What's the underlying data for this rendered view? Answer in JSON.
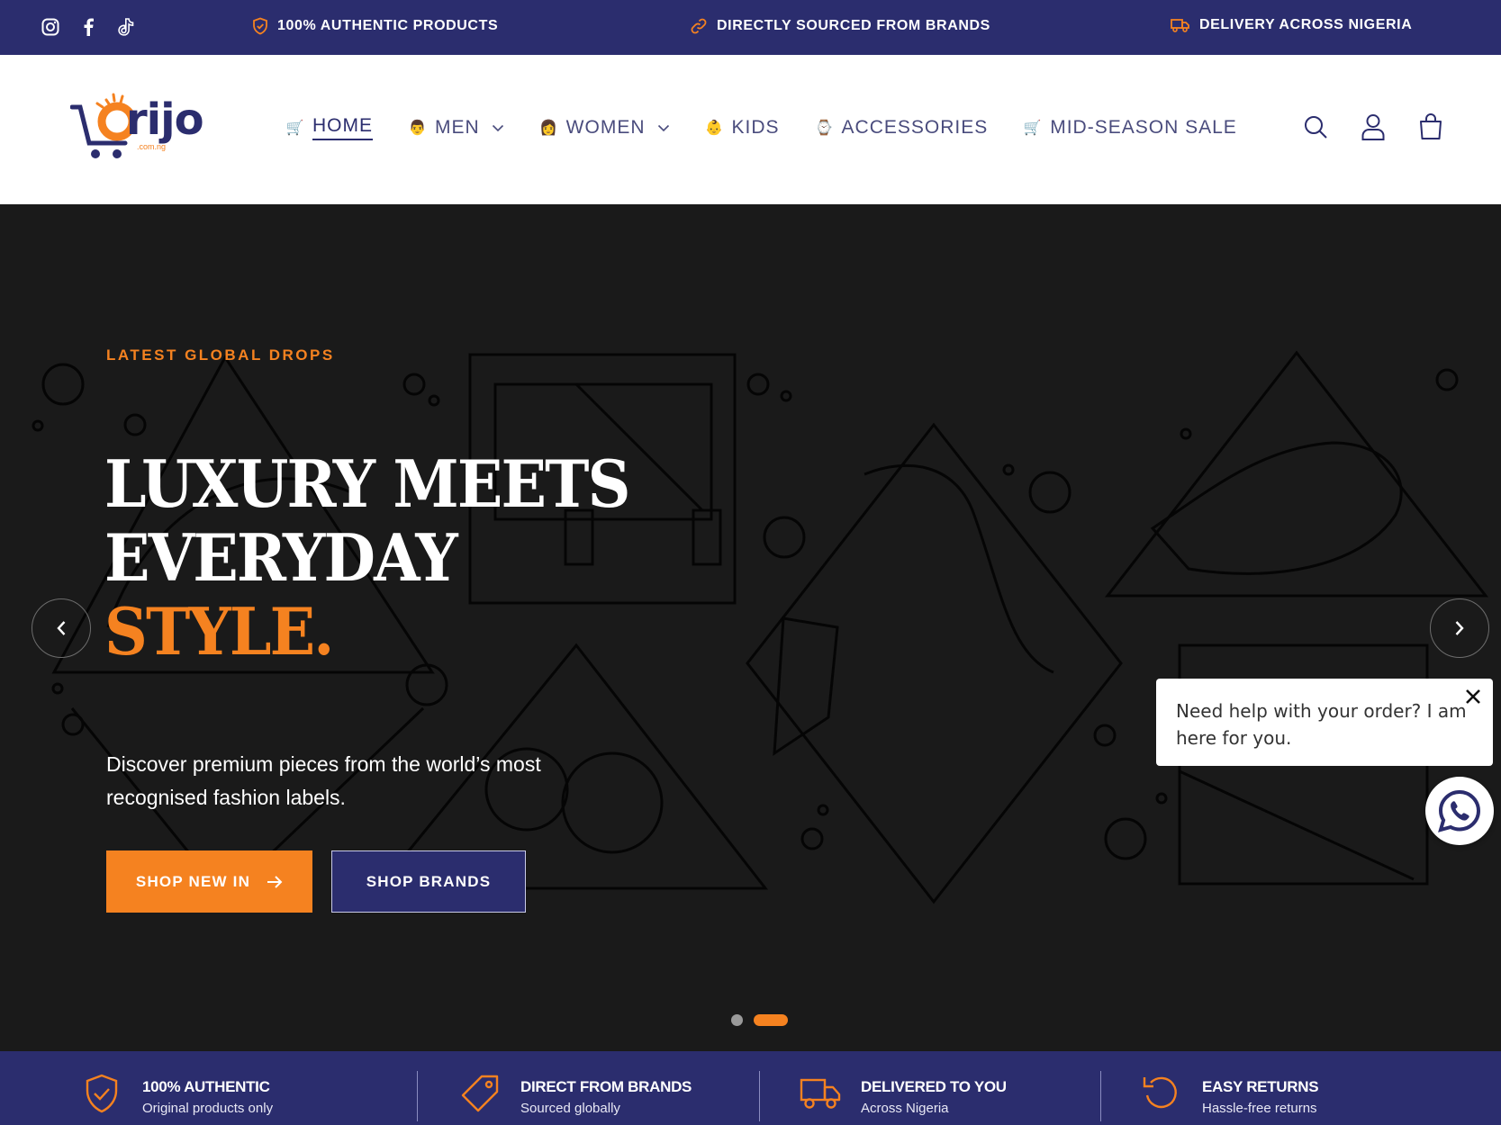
{
  "topbar": {
    "social": [
      "instagram-icon",
      "facebook-icon",
      "tiktok-icon"
    ],
    "promos": [
      {
        "icon": "shield-check-icon",
        "text": "100% AUTHENTIC PRODUCTS"
      },
      {
        "icon": "link-icon",
        "text": "DIRECTLY SOURCED FROM BRANDS"
      },
      {
        "icon": "truck-icon",
        "text": "DELIVERY ACROSS NIGERIA"
      }
    ]
  },
  "header": {
    "logo": {
      "word": "rijo",
      "domain": ".com.ng"
    },
    "nav": [
      {
        "emoji": "🛒",
        "label": "HOME",
        "active": true
      },
      {
        "emoji": "👨",
        "label": "MEN",
        "dropdown": true
      },
      {
        "emoji": "👩",
        "label": "WOMEN",
        "dropdown": true
      },
      {
        "emoji": "👶",
        "label": "KIDS"
      },
      {
        "emoji": "⌚",
        "label": "ACCESSORIES"
      },
      {
        "emoji": "🛒",
        "label": "MID-SEASON SALE"
      }
    ],
    "icons": [
      "search-icon",
      "account-icon",
      "cart-icon"
    ]
  },
  "hero": {
    "eyebrow": "LATEST GLOBAL DROPS",
    "headline_line1": "LUXURY MEETS",
    "headline_line2": "EVERYDAY",
    "headline_accent": "STYLE.",
    "subtext": "Discover premium pieces from the world’s most recognised fashion labels.",
    "cta_primary": "SHOP NEW IN",
    "cta_secondary": "SHOP BRANDS",
    "slides_total": 2,
    "slide_active": 2
  },
  "chat": {
    "message": "Need help with your order? I am here for you."
  },
  "features": [
    {
      "icon": "shield-check-icon",
      "title": "100% AUTHENTIC",
      "subtitle": "Original products only"
    },
    {
      "icon": "tag-icon",
      "title": "DIRECT FROM BRANDS",
      "subtitle": "Sourced globally"
    },
    {
      "icon": "truck-icon",
      "title": "DELIVERED TO YOU",
      "subtitle": "Across Nigeria"
    },
    {
      "icon": "return-icon",
      "title": "EASY RETURNS",
      "subtitle": "Hassle-free returns"
    }
  ],
  "colors": {
    "navy": "#2b2d6e",
    "orange": "#f58220",
    "hero_bg": "#1a1a1a"
  }
}
